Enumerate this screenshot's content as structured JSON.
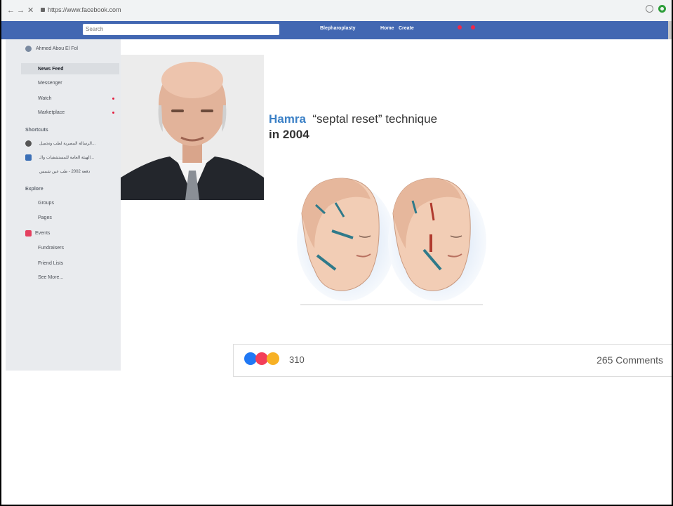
{
  "browser": {
    "url": "https://www.facebook.com"
  },
  "topbar": {
    "search_placeholder": "Search",
    "profile_link": "Blepharoplasty",
    "home_link": "Home",
    "create_link": "Create"
  },
  "sidebar": {
    "user_name": "Ahmed Abou El Fol",
    "items": [
      {
        "label": "News Feed"
      },
      {
        "label": "Messenger"
      },
      {
        "label": "Watch"
      },
      {
        "label": "Marketplace"
      }
    ],
    "shortcuts_title": "Shortcuts",
    "shortcuts": [
      {
        "label": "الرسالة المصرية لطب وتجميل..."
      },
      {
        "label": "الهيئة العامة للمستشفيات والـ..."
      },
      {
        "label": "دفعة 2002 - طب عين شمس"
      }
    ],
    "explore_title": "Explore",
    "explore": [
      {
        "label": "Groups"
      },
      {
        "label": "Pages"
      },
      {
        "label": "Events"
      },
      {
        "label": "Fundraisers"
      },
      {
        "label": "Friend Lists"
      },
      {
        "label": "See More..."
      }
    ]
  },
  "post": {
    "author_highlight": "Hamra",
    "technique": "“septal reset” technique",
    "year": "in 2004",
    "reactions_count": "310",
    "comments": "265 Comments"
  },
  "colors": {
    "facebook_blue": "#4267b2",
    "highlight": "#3b80c6",
    "sidebar_bg": "#e9ebee"
  }
}
